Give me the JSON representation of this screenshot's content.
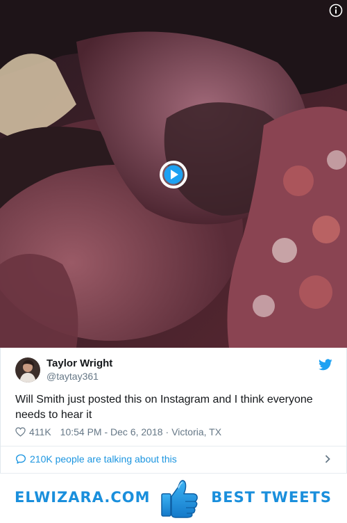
{
  "media": {
    "alt": "video still of a couple kissing"
  },
  "tweet": {
    "author_name": "Taylor Wright",
    "author_handle": "@taytay361",
    "text": "Will Smith just posted this on Instagram and I think everyone needs to hear it",
    "like_count": "411K",
    "time": "10:54 PM - Dec 6, 2018",
    "separator": "·",
    "location": "Victoria, TX",
    "talking_label": "210K people are talking about this"
  },
  "banner": {
    "left_text": "ELWIZARA.COM",
    "right_text": "BEST TWEETS"
  },
  "colors": {
    "twitter_blue": "#1da1f2",
    "link_blue": "#1b95e0",
    "brand_blue": "#1a8fdc",
    "text": "#14171a",
    "muted": "#657786"
  },
  "icons": [
    "info-icon",
    "play-icon",
    "twitter-bird-icon",
    "heart-icon",
    "speech-bubble-icon",
    "chevron-right-icon",
    "thumbs-up-icon"
  ]
}
